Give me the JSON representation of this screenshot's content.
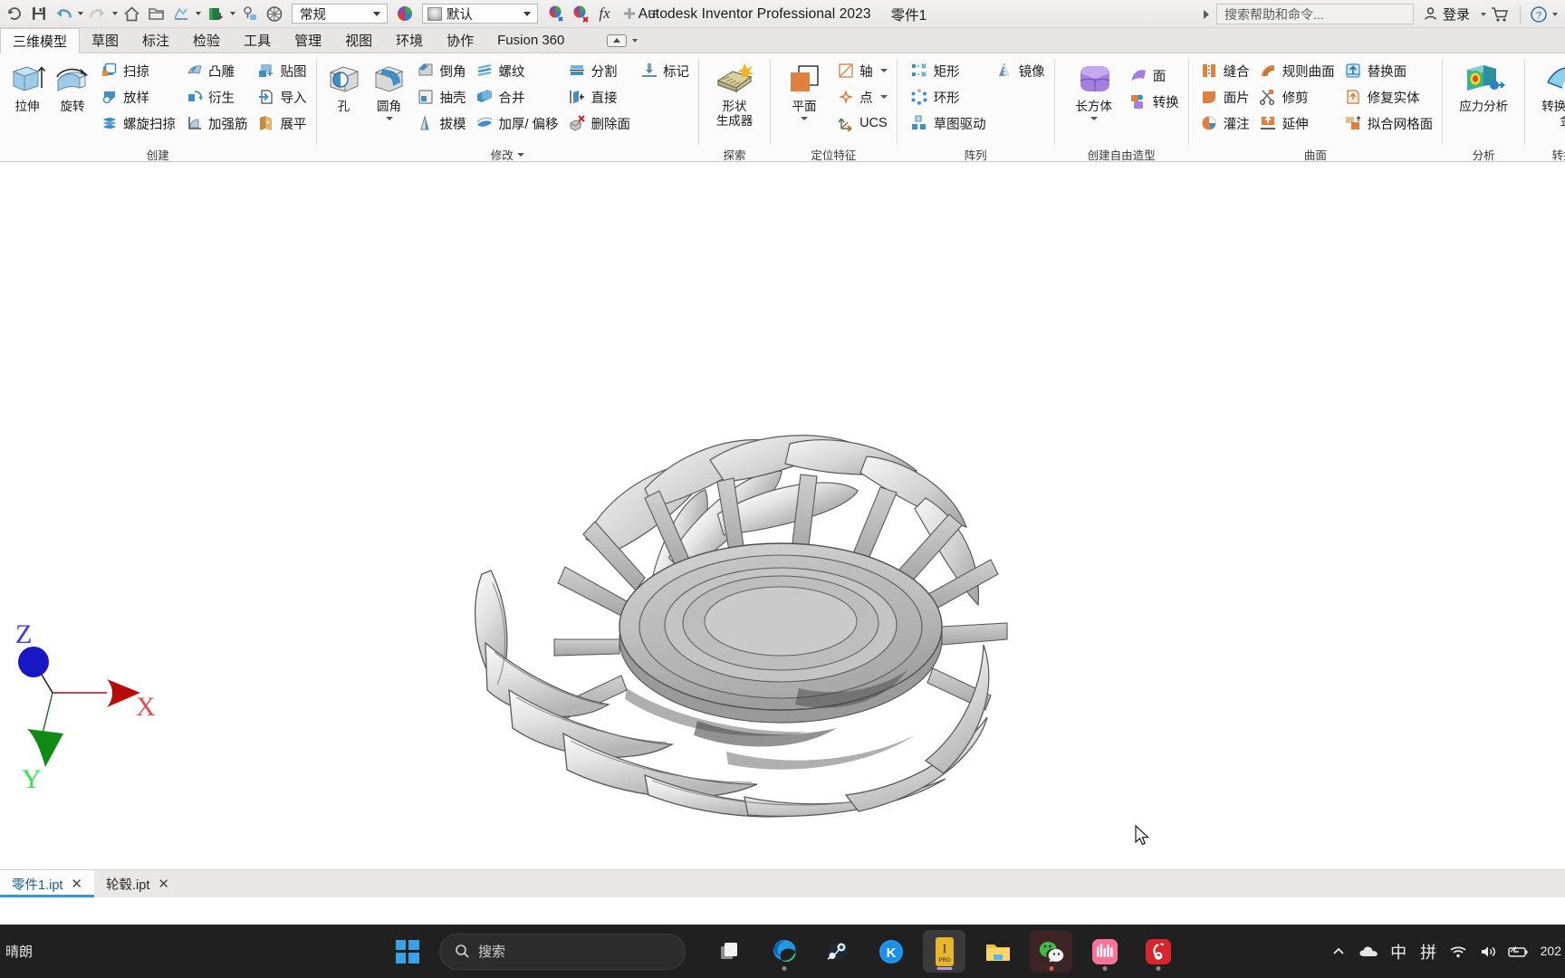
{
  "window": {
    "title": "Autodesk Inventor Professional 2023",
    "document": "零件1"
  },
  "quick_access": {
    "icons": [
      {
        "name": "refresh-icon",
        "label": "刷新"
      },
      {
        "name": "save-icon",
        "label": "保存"
      },
      {
        "name": "undo-icon",
        "label": "撤消"
      },
      {
        "name": "redo-icon",
        "label": "重做"
      },
      {
        "name": "home-icon",
        "label": "主页"
      },
      {
        "name": "open-folder-icon",
        "label": "打开"
      },
      {
        "name": "update-icon",
        "label": "更新"
      },
      {
        "name": "material-box-icon",
        "label": "材料"
      },
      {
        "name": "select-icon",
        "label": "选择"
      },
      {
        "name": "appearance-icon",
        "label": "外观"
      }
    ],
    "style_value": "常规",
    "material_value": "默认",
    "clear_appearance_label": "清除外观替代",
    "fx_label": "fx",
    "add_label": "添加"
  },
  "help": {
    "search_placeholder": "搜索帮助和命令...",
    "signin_label": "登录",
    "cart_name": "cart-icon",
    "help_name": "help-icon"
  },
  "tabs": [
    {
      "label": "三维模型",
      "active": true
    },
    {
      "label": "草图",
      "active": false
    },
    {
      "label": "标注",
      "active": false
    },
    {
      "label": "检验",
      "active": false
    },
    {
      "label": "工具",
      "active": false
    },
    {
      "label": "管理",
      "active": false
    },
    {
      "label": "视图",
      "active": false
    },
    {
      "label": "环境",
      "active": false
    },
    {
      "label": "协作",
      "active": false
    },
    {
      "label": "Fusion 360",
      "active": false
    }
  ],
  "ribbon": {
    "panels": [
      {
        "title": "创建",
        "has_caret": false,
        "big": [
          {
            "label": "拉伸",
            "icon": "extrude-icon"
          },
          {
            "label": "旋转",
            "icon": "revolve-icon"
          }
        ],
        "columns": [
          [
            {
              "label": "扫掠",
              "icon": "sweep-icon"
            },
            {
              "label": "放样",
              "icon": "loft-icon"
            },
            {
              "label": "螺旋扫掠",
              "icon": "coil-icon"
            }
          ],
          [
            {
              "label": "凸雕",
              "icon": "emboss-icon"
            },
            {
              "label": "衍生",
              "icon": "derive-icon"
            },
            {
              "label": "加强筋",
              "icon": "rib-icon"
            }
          ],
          [
            {
              "label": "贴图",
              "icon": "decal-icon"
            },
            {
              "label": "导入",
              "icon": "import-icon"
            },
            {
              "label": "展平",
              "icon": "unfold-icon"
            }
          ]
        ]
      },
      {
        "title": "修改",
        "has_caret": true,
        "big": [
          {
            "label": "孔",
            "icon": "hole-icon"
          },
          {
            "label": "圆角",
            "icon": "fillet-icon",
            "caret": true
          }
        ],
        "columns": [
          [
            {
              "label": "倒角",
              "icon": "chamfer-icon"
            },
            {
              "label": "抽壳",
              "icon": "shell-icon"
            },
            {
              "label": "拔模",
              "icon": "draft-icon"
            }
          ],
          [
            {
              "label": "螺纹",
              "icon": "thread-icon"
            },
            {
              "label": "合并",
              "icon": "combine-icon"
            },
            {
              "label": "加厚/ 偏移",
              "icon": "thicken-icon"
            }
          ],
          [
            {
              "label": "分割",
              "icon": "split-icon"
            },
            {
              "label": "直接",
              "icon": "direct-icon"
            },
            {
              "label": "删除面",
              "icon": "delete-face-icon"
            }
          ],
          [
            {
              "label": "标记",
              "icon": "mark-icon"
            }
          ]
        ]
      },
      {
        "title": "探索",
        "has_caret": false,
        "big": [
          {
            "label": "形状\n生成器",
            "icon": "shape-generator-icon"
          }
        ],
        "columns": []
      },
      {
        "title": "定位特征",
        "has_caret": false,
        "big": [
          {
            "label": "平面",
            "icon": "plane-icon",
            "caret": true
          }
        ],
        "columns": [
          [
            {
              "label": "轴",
              "icon": "axis-icon",
              "caret": true
            },
            {
              "label": "点",
              "icon": "point-icon",
              "caret": true
            },
            {
              "label": "UCS",
              "icon": "ucs-icon"
            }
          ]
        ]
      },
      {
        "title": "阵列",
        "has_caret": false,
        "big": [],
        "columns": [
          [
            {
              "label": "矩形",
              "icon": "rect-pattern-icon"
            },
            {
              "label": "环形",
              "icon": "circular-pattern-icon"
            },
            {
              "label": "草图驱动",
              "icon": "sketch-driven-icon"
            }
          ],
          [
            {
              "label": "镜像",
              "icon": "mirror-icon"
            }
          ]
        ]
      },
      {
        "title": "创建自由造型",
        "has_caret": false,
        "big": [
          {
            "label": "长方体",
            "icon": "freeform-box-icon",
            "caret": true
          }
        ],
        "columns": [
          [
            {
              "label": "面",
              "icon": "freeform-face-icon"
            },
            {
              "label": "转换",
              "icon": "freeform-convert-icon"
            }
          ]
        ]
      },
      {
        "title": "曲面",
        "has_caret": false,
        "big": [],
        "columns": [
          [
            {
              "label": "缝合",
              "icon": "stitch-icon"
            },
            {
              "label": "面片",
              "icon": "patch-icon"
            },
            {
              "label": "灌注",
              "icon": "sculpt-icon"
            }
          ],
          [
            {
              "label": "规则曲面",
              "icon": "ruled-surface-icon"
            },
            {
              "label": "修剪",
              "icon": "trim-icon"
            },
            {
              "label": "延伸",
              "icon": "extend-icon"
            }
          ],
          [
            {
              "label": "替换面",
              "icon": "replace-face-icon"
            },
            {
              "label": "修复实体",
              "icon": "repair-body-icon"
            },
            {
              "label": "拟合网格面",
              "icon": "fit-mesh-icon"
            }
          ]
        ]
      },
      {
        "title": "分析",
        "has_caret": false,
        "big": [
          {
            "label": "应力分析",
            "icon": "stress-analysis-icon"
          }
        ],
        "columns": []
      },
      {
        "title": "转换",
        "has_caret": false,
        "big": [
          {
            "label": "转换为钣金",
            "icon": "convert-sheetmetal-icon"
          }
        ],
        "columns": []
      }
    ]
  },
  "canvas": {
    "axis": {
      "x_label": "X",
      "y_label": "Y",
      "z_label": "Z",
      "x_color": "#c00000",
      "y_color": "#00a000",
      "z_color": "#0000c8"
    },
    "model_name": "麦克纳姆轮",
    "cursor_name": "mouse-pointer"
  },
  "doc_tabs": [
    {
      "label": "零件1.ipt",
      "active": true
    },
    {
      "label": "轮毂.ipt",
      "active": false
    }
  ],
  "taskbar": {
    "weather_text": "晴朗",
    "search_placeholder": "搜索",
    "apps": [
      {
        "name": "taskview-icon",
        "label": "任务视图"
      },
      {
        "name": "edge-icon",
        "label": "Microsoft Edge"
      },
      {
        "name": "steam-icon",
        "label": "Steam"
      },
      {
        "name": "kugou-icon",
        "label": "酷狗音乐"
      },
      {
        "name": "inventor-icon",
        "label": "Inventor Professional"
      },
      {
        "name": "explorer-icon",
        "label": "文件资源管理器"
      },
      {
        "name": "wechat-icon",
        "label": "微信"
      },
      {
        "name": "bilibili-icon",
        "label": "哔哩哔哩"
      },
      {
        "name": "netease-music-icon",
        "label": "网易云音乐"
      }
    ],
    "tray": [
      {
        "name": "show-hidden-icons-icon",
        "label": "^"
      },
      {
        "name": "onedrive-icon",
        "label": "OneDrive"
      },
      {
        "name": "ime-mode-icon",
        "label": "中"
      },
      {
        "name": "ime-pinyin-icon",
        "label": "拼"
      },
      {
        "name": "wifi-icon",
        "label": "网络"
      },
      {
        "name": "volume-icon",
        "label": "音量"
      },
      {
        "name": "battery-icon",
        "label": "电池"
      }
    ],
    "clock": "202"
  }
}
